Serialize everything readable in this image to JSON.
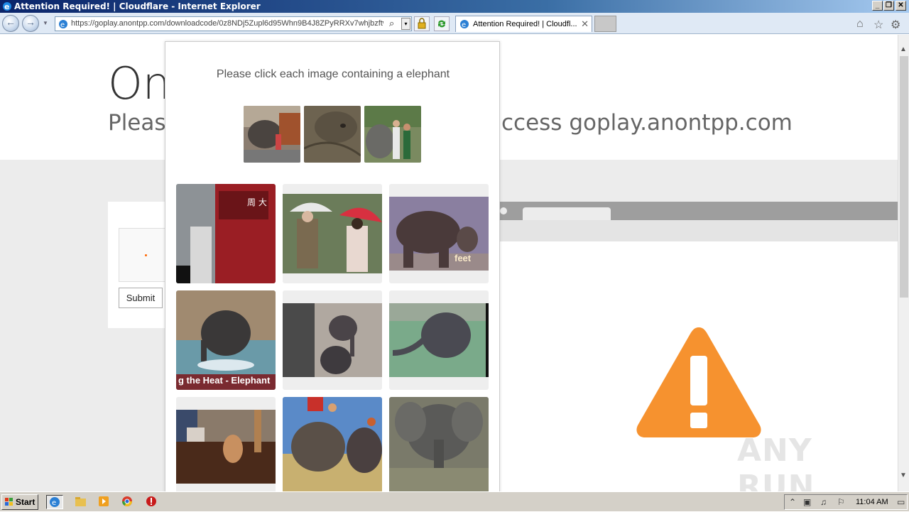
{
  "window": {
    "title": "Attention Required! | Cloudflare - Internet Explorer",
    "min_label": "_",
    "max_label": "❐",
    "close_label": "✕"
  },
  "addressbar": {
    "url": "https://goplay.anontpp.com/downloadcode/0z8NDj5Zupl6d95Whn9B4J8ZPyRRXv7whjbzftw",
    "search_glyph": "⌕",
    "dropdown_glyph": "▾"
  },
  "tab": {
    "label": "Attention Required! | Cloudfl...",
    "close": "✕"
  },
  "page": {
    "heading_partial": "On",
    "subtitle_left": "Please",
    "subtitle_right": "ccess goplay.anontpp.com",
    "submit_label": "Submit"
  },
  "captcha": {
    "prompt": "Please click each image containing a elephant",
    "tile_captions": {
      "tile_3": "feet",
      "tile_4": "g the Heat - Elephant"
    }
  },
  "watermark": "ANY RUN",
  "taskbar": {
    "start_label": "Start",
    "clock": "11:04 AM"
  },
  "colors": {
    "warning": "#f6922f",
    "titlebar": "#0a246a",
    "modal_border": "#cccccc"
  }
}
